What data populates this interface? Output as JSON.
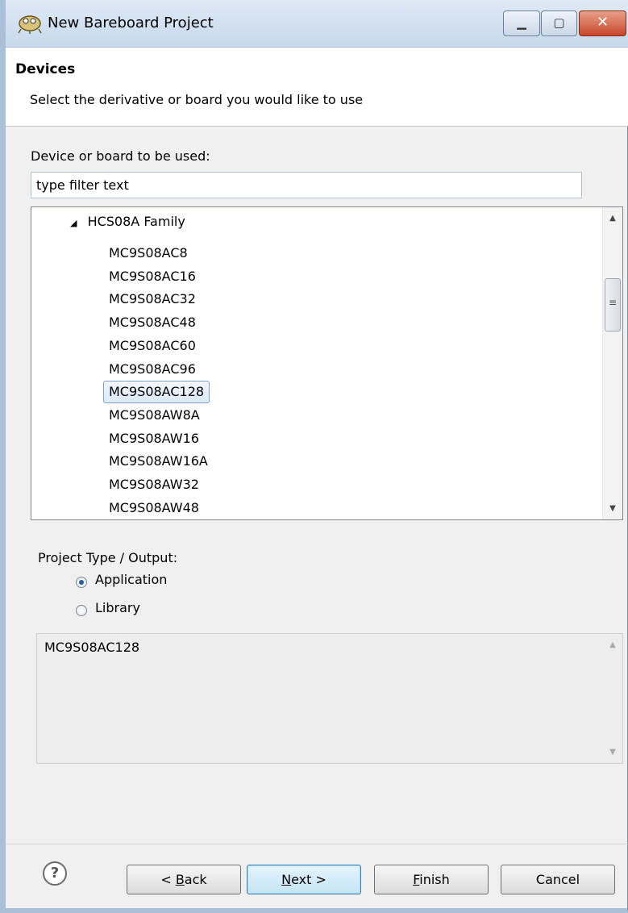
{
  "window": {
    "title": "New Bareboard Project",
    "controls": {
      "minimize": "▁",
      "maximize": "▢",
      "close": "✕"
    }
  },
  "header": {
    "title": "Devices",
    "description": "Select the derivative or board you would like to use"
  },
  "device_label": "Device or board to be used:",
  "filter": {
    "value": "type filter text"
  },
  "tree": {
    "family": "HCS08A Family",
    "items": [
      "MC9S08AC8",
      "MC9S08AC16",
      "MC9S08AC32",
      "MC9S08AC48",
      "MC9S08AC60",
      "MC9S08AC96",
      "MC9S08AC128",
      "MC9S08AW8A",
      "MC9S08AW16",
      "MC9S08AW16A",
      "MC9S08AW32",
      "MC9S08AW48"
    ],
    "selected_index": 6
  },
  "project_type": {
    "label": "Project Type / Output:",
    "options": [
      "Application",
      "Library"
    ],
    "selected": "Application"
  },
  "description_box": {
    "text": "MC9S08AC128"
  },
  "buttons": {
    "back": {
      "mnemonic": "B",
      "rest": "ack",
      "prefix": "< "
    },
    "next": {
      "mnemonic": "N",
      "rest": "ext >"
    },
    "finish": {
      "mnemonic": "F",
      "rest": "inish"
    },
    "cancel": "Cancel",
    "help": "?"
  },
  "colors": {
    "selection_fill": "#dbe9f9",
    "selection_border": "#7da2ce",
    "close_button": "#c9462b",
    "radio_dot": "#2a5ea8"
  }
}
